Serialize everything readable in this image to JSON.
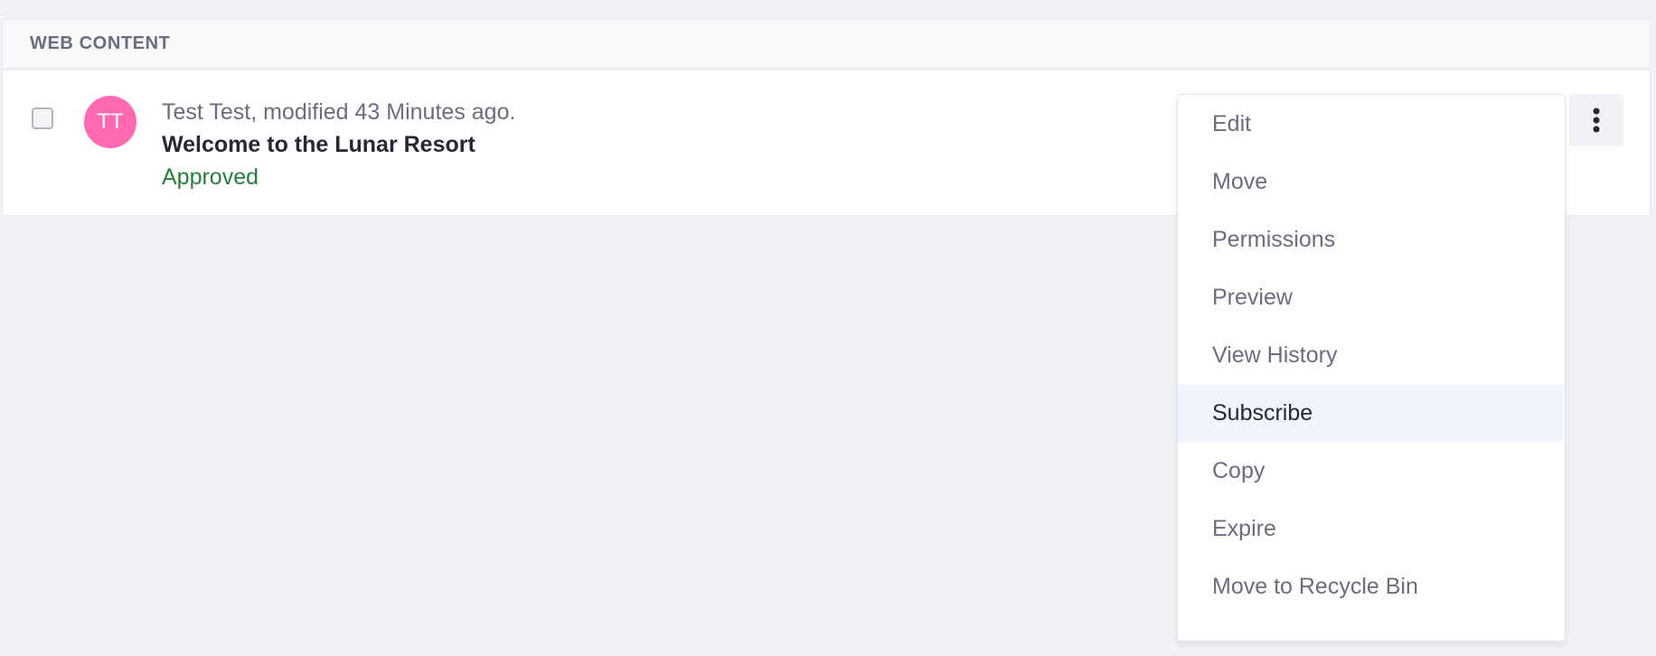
{
  "panel": {
    "header": "WEB CONTENT"
  },
  "entry": {
    "avatar_initials": "TT",
    "meta": "Test Test, modified 43 Minutes ago.",
    "title": "Welcome to the Lunar Resort",
    "status": "Approved",
    "avatar_color": "#ff69b0",
    "status_color": "#287d3c"
  },
  "menu": {
    "items": [
      {
        "label": "Edit"
      },
      {
        "label": "Move"
      },
      {
        "label": "Permissions"
      },
      {
        "label": "Preview"
      },
      {
        "label": "View History"
      },
      {
        "label": "Subscribe"
      },
      {
        "label": "Copy"
      },
      {
        "label": "Expire"
      },
      {
        "label": "Move to Recycle Bin"
      }
    ],
    "highlighted": "Subscribe"
  },
  "icons": {
    "kebab": "vertical-ellipsis-icon"
  }
}
